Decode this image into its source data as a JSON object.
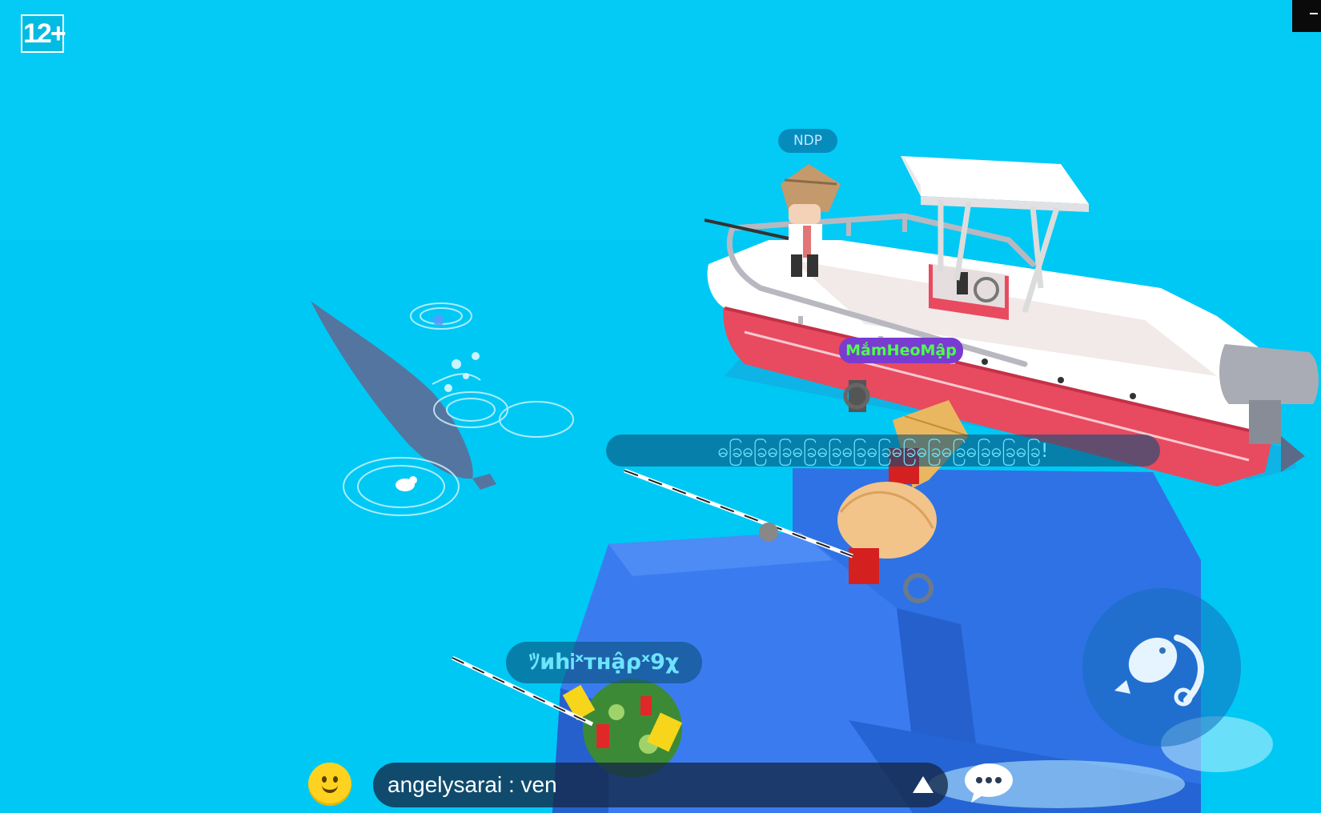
{
  "hud": {
    "age_rating": "12+"
  },
  "players": {
    "ndp_name": "NDP",
    "mam_name": "MắmHeoMập",
    "long_chat": "ဓခြဓခြဓခြဓခြဓခြဓခြဓခြဓခြဓခြဓခြဓခြဓခြဓခြ!",
    "player3_name": "ﾂиhᎥˣтнậρˣ9χ"
  },
  "chat": {
    "last_message": "angelysarai : ven"
  },
  "colors": {
    "water": "#00c8f4",
    "boat_hull": "#ffffff",
    "boat_stripe": "#e84a5f",
    "blue_blocks": "#2f6fe0",
    "whale": "#5a6a9a",
    "name_tag_purple": "#7a3bd1",
    "name_tag_green_text": "#4cff4c"
  },
  "icons": {
    "emoji": "smiley-face-icon",
    "expand": "triangle-up-icon",
    "chat": "speech-bubble-icon",
    "fish": "fishing-rod-fish-icon"
  }
}
